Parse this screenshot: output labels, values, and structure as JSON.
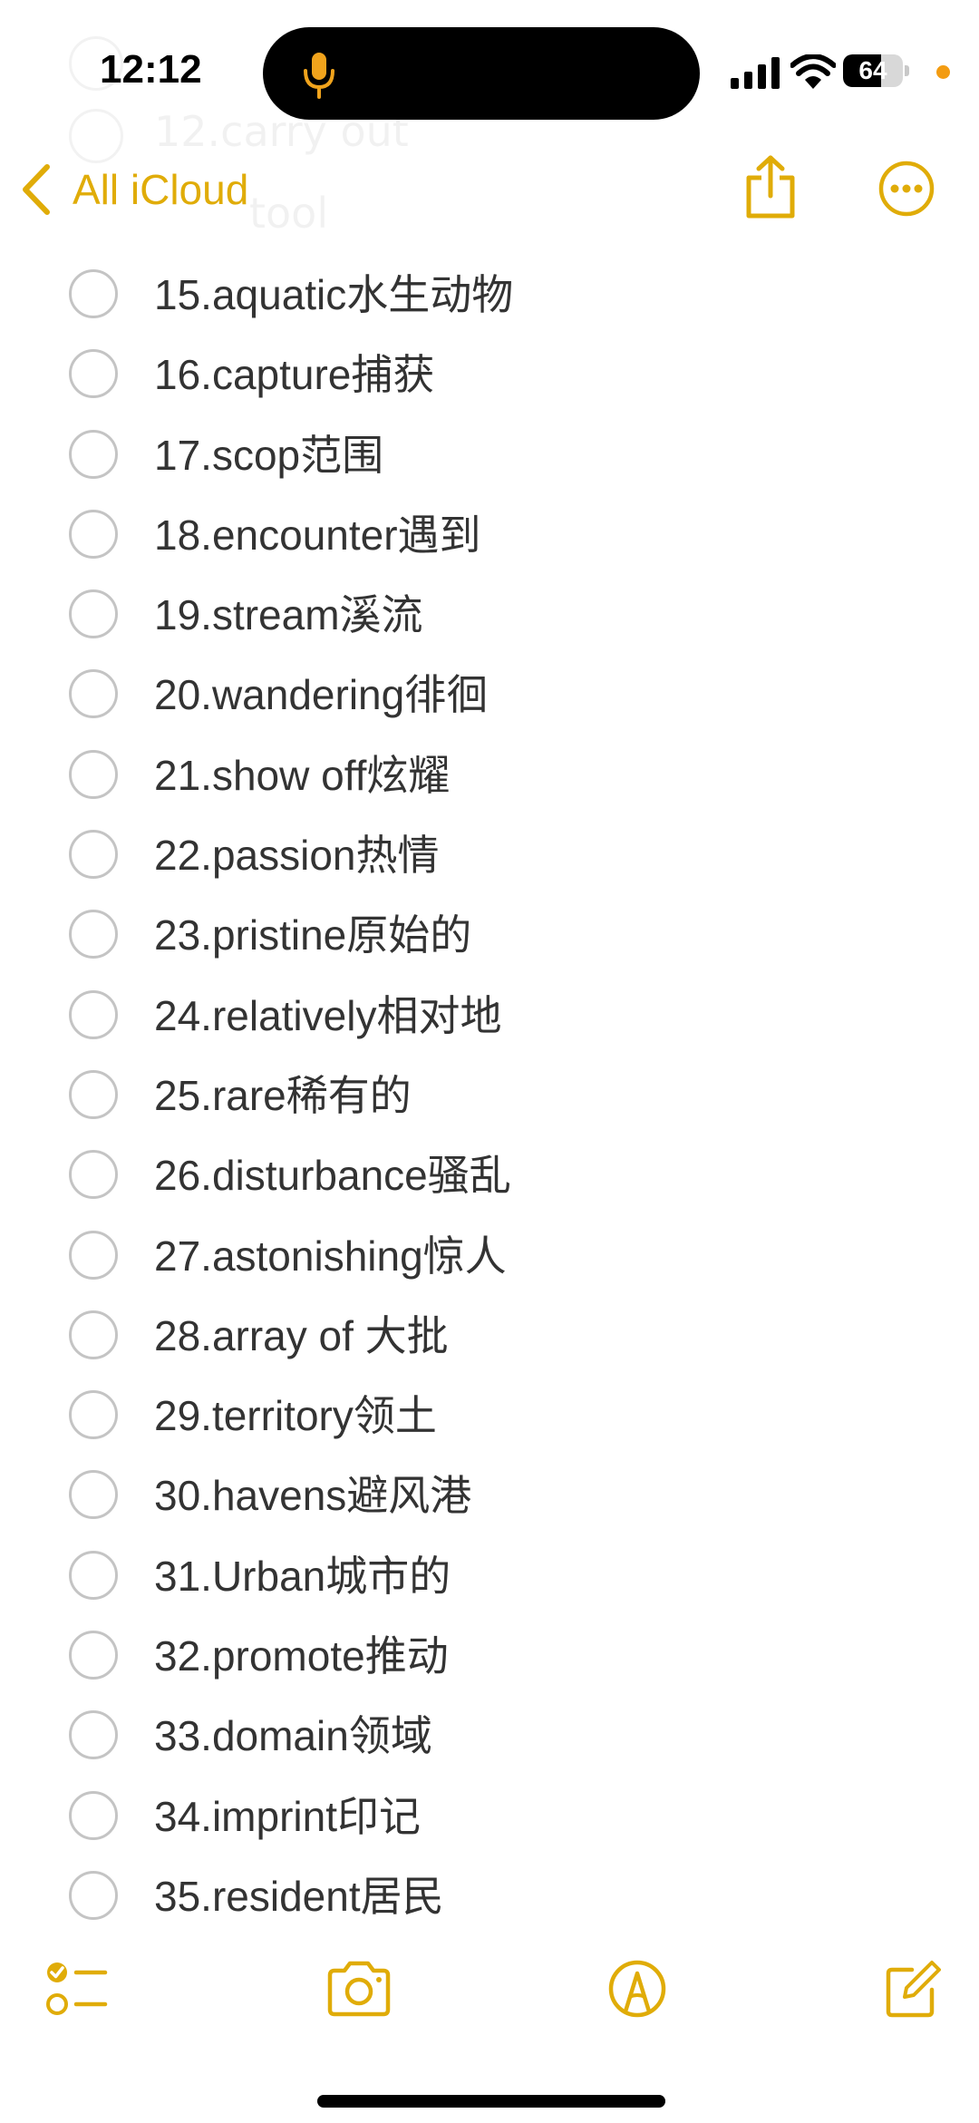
{
  "status_bar": {
    "time": "12:12",
    "battery": "64",
    "battery_level": 0.64
  },
  "nav": {
    "back_label": "All iCloud"
  },
  "checklist": [
    {
      "label": "15.aquatic水生动物"
    },
    {
      "label": "16.capture捕获"
    },
    {
      "label": "17.scop范围"
    },
    {
      "label": "18.encounter遇到"
    },
    {
      "label": "19.stream溪流"
    },
    {
      "label": "20.wandering徘徊"
    },
    {
      "label": "21.show off炫耀"
    },
    {
      "label": "22.passion热情"
    },
    {
      "label": "23.pristine原始的"
    },
    {
      "label": "24.relatively相对地"
    },
    {
      "label": "25.rare稀有的"
    },
    {
      "label": "26.disturbance骚乱"
    },
    {
      "label": "27.astonishing惊人"
    },
    {
      "label": "28.array of 大批"
    },
    {
      "label": "29.territory领土"
    },
    {
      "label": "30.havens避风港"
    },
    {
      "label": "31.Urban城市的"
    },
    {
      "label": "32.promote推动"
    },
    {
      "label": "33.domain领域"
    },
    {
      "label": "34.imprint印记"
    },
    {
      "label": "35.resident居民"
    }
  ],
  "icons": {
    "back": "chevron-left-icon",
    "share": "share-icon",
    "more": "ellipsis-circle-icon",
    "toolbar_checklist": "checklist-icon",
    "toolbar_camera": "camera-icon",
    "toolbar_markup": "markup-pen-icon",
    "toolbar_compose": "compose-icon"
  },
  "colors": {
    "accent": "#e0ac08",
    "text": "#333333",
    "circle": "#c4c4c4",
    "privacy_dot": "#f39c12"
  }
}
